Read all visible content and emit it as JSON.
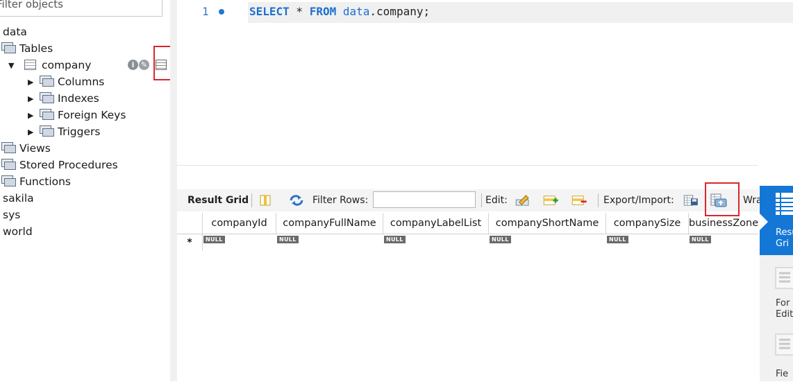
{
  "navigator": {
    "filter_placeholder": "Filter objects",
    "tree": {
      "schema_data": "data",
      "tables": "Tables",
      "company": "company",
      "columns": "Columns",
      "indexes": "Indexes",
      "foreign_keys": "Foreign Keys",
      "triggers": "Triggers",
      "views": "Views",
      "stored_procedures": "Stored Procedures",
      "functions": "Functions",
      "schema_sakila": "sakila",
      "schema_sys": "sys",
      "schema_world": "world"
    },
    "icons": {
      "info": "info-icon",
      "wrench": "wrench-icon",
      "table_inspect": "table-grid-icon"
    }
  },
  "editor": {
    "line_number": "1",
    "sql": {
      "kw1": "SELECT",
      "star": " * ",
      "kw2": "FROM",
      "space": " ",
      "schema": "data",
      "rest": ".company;"
    }
  },
  "results": {
    "toolbar": {
      "result_grid": "Result Grid",
      "filter_rows": "Filter Rows:",
      "filter_value": "",
      "edit": "Edit:",
      "export_import": "Export/Import:",
      "wrap": "Wra"
    },
    "columns": [
      "companyId",
      "companyFullName",
      "companyLabelList",
      "companyShortName",
      "companySize",
      "businessZone"
    ],
    "row_marker": "*",
    "null_text": "NULL"
  },
  "side_panel": {
    "result_grid": "Resu\nGri",
    "form_editor": "For\nEdit",
    "field_types": "Fie"
  },
  "colors": {
    "highlight_box": "#d9262b",
    "keyword": "#1e6fd0",
    "active_side": "#1477d6"
  }
}
